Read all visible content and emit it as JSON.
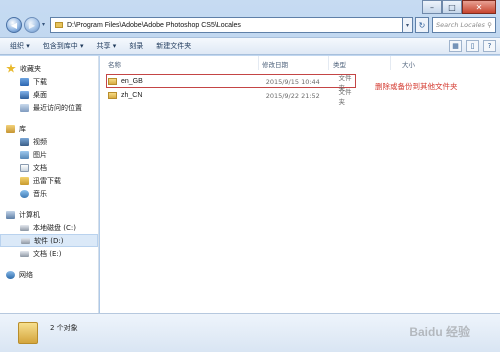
{
  "window": {
    "controls": {
      "minimize": "–",
      "maximize": "□",
      "close": "✕"
    }
  },
  "address": {
    "path": "D:\\Program Files\\Adobe\\Adobe Photoshop CS5\\Locales",
    "search_placeholder": "Search Locales",
    "search_icon": "magnifier-icon"
  },
  "toolbar": {
    "items": [
      "组织 ▾",
      "包含到库中 ▾",
      "共享 ▾",
      "刻录",
      "新建文件夹"
    ]
  },
  "sidebar": {
    "items": [
      {
        "label": "收藏夹",
        "group": true,
        "icon": "star-icon"
      },
      {
        "label": "下载",
        "icon": "download-folder-icon"
      },
      {
        "label": "桌面",
        "icon": "desktop-icon"
      },
      {
        "label": "最近访问的位置",
        "icon": "recent-places-icon"
      },
      {
        "label": "库",
        "group": true,
        "icon": "library-icon"
      },
      {
        "label": "视频",
        "icon": "videos-icon"
      },
      {
        "label": "图片",
        "icon": "pictures-icon"
      },
      {
        "label": "文档",
        "icon": "documents-icon"
      },
      {
        "label": "迅雷下载",
        "icon": "xunlei-download-icon"
      },
      {
        "label": "音乐",
        "icon": "music-icon"
      },
      {
        "label": "计算机",
        "group": true,
        "icon": "computer-icon"
      },
      {
        "label": "本地磁盘 (C:)",
        "icon": "drive-icon"
      },
      {
        "label": "软件 (D:)",
        "icon": "drive-icon",
        "selected": true
      },
      {
        "label": "文档 (E:)",
        "icon": "drive-icon"
      },
      {
        "label": "网络",
        "group": true,
        "icon": "network-icon"
      }
    ]
  },
  "columns": {
    "name": "名称",
    "modified": "修改日期",
    "type": "类型",
    "size": "大小"
  },
  "files": [
    {
      "name": "en_GB",
      "modified": "2015/9/15 10:44",
      "type": "文件夹"
    },
    {
      "name": "zh_CN",
      "modified": "2015/9/22 21:52",
      "type": "文件夹"
    }
  ],
  "annotation": "删除或备份到其他文件夹",
  "status": {
    "count_text": "2 个对象"
  },
  "watermark": "Baidu 经验",
  "colors": {
    "annotation_red": "#d4392f",
    "frame_blue": "#b7d0ec",
    "folder_yellow": "#e7c35c"
  }
}
